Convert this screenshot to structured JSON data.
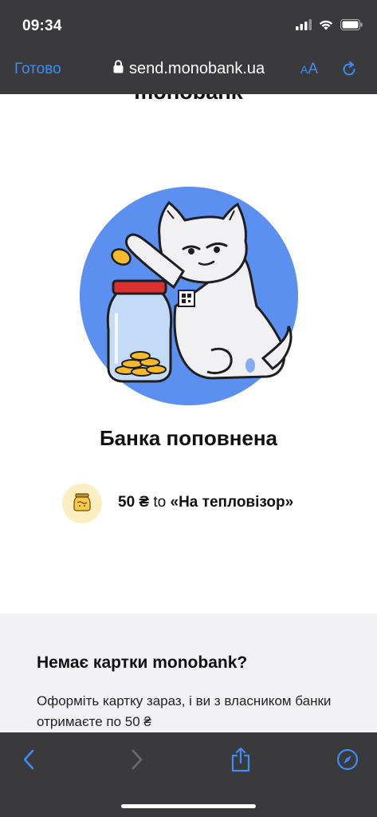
{
  "status_bar": {
    "time": "09:34"
  },
  "browser": {
    "done_label": "Готово",
    "url": "send.monobank.ua",
    "text_size_small": "A",
    "text_size_large": "A"
  },
  "page": {
    "brand_cut_text": "monobank",
    "title": "Банка поповнена",
    "transfer": {
      "amount": "50 ₴",
      "preposition": "to",
      "jar_name": "«На тепловізор»"
    },
    "promo": {
      "title": "Немає картки monobank?",
      "text": "Оформіть картку зараз, і ви з власником банки отримаєте по 50 ₴"
    }
  },
  "colors": {
    "chrome_bg": "#3a3a3c",
    "accent_blue": "#3e8cf5",
    "illustration_circle": "#5b8ff0",
    "jar_badge_bg": "#fbeec0",
    "promo_bg": "#f2f2f4"
  },
  "icons": {
    "lock": "lock-icon",
    "reload": "reload-icon",
    "back": "chevron-left-icon",
    "forward": "chevron-right-icon",
    "share": "share-icon",
    "compass": "compass-icon"
  }
}
